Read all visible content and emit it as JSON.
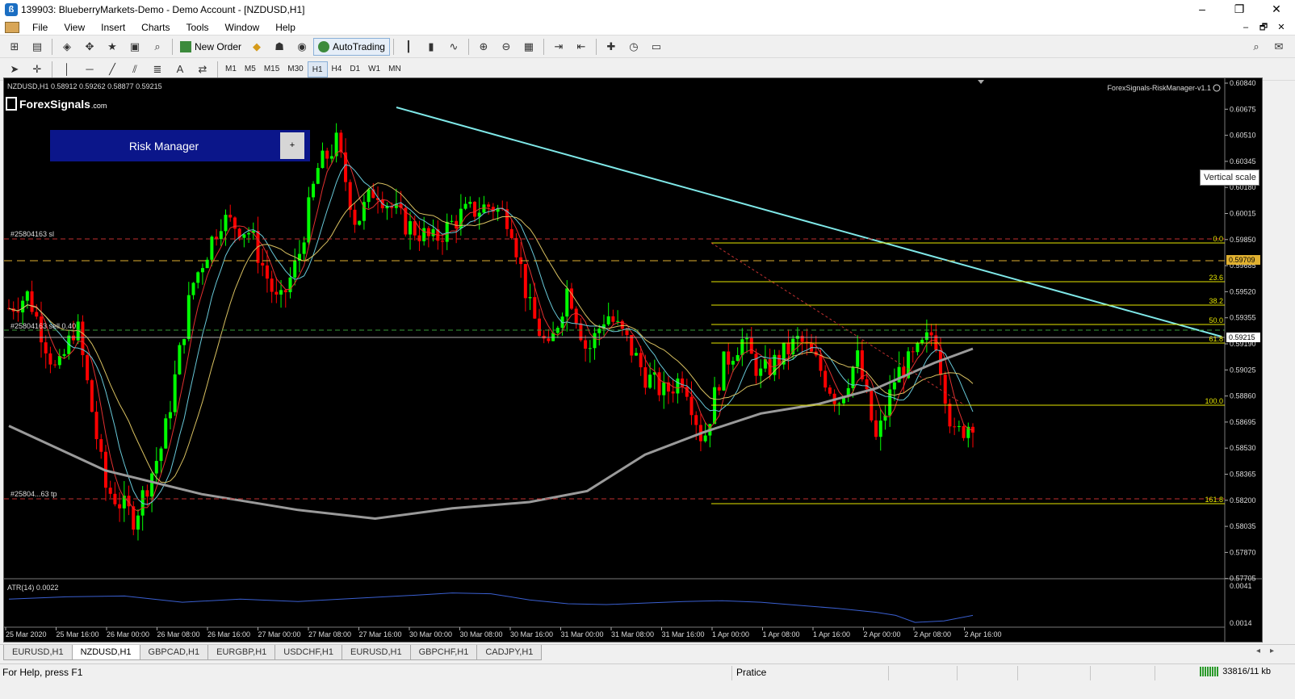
{
  "window": {
    "title": "139903: BlueberryMarkets-Demo - Demo Account - [NZDUSD,H1]",
    "controls": [
      "–",
      "❐",
      "✕"
    ]
  },
  "menu": {
    "items": [
      "File",
      "View",
      "Insert",
      "Charts",
      "Tools",
      "Window",
      "Help"
    ],
    "mdi_controls": [
      "–",
      "🗗",
      "✕"
    ]
  },
  "toolbar": {
    "new_order": "New Order",
    "autotrading": "AutoTrading",
    "timeframes": [
      "M1",
      "M5",
      "M15",
      "M30",
      "H1",
      "H4",
      "D1",
      "W1",
      "MN"
    ],
    "active_timeframe": "H1"
  },
  "chart": {
    "symbol_info": "NZDUSD,H1  0.58912 0.59262 0.58877 0.59215",
    "ea_label": "ForexSignals-RiskManager-v1.1",
    "logo_text": "ForexSignals",
    "logo_suffix": ".com",
    "risk_manager_label": "Risk Manager",
    "risk_manager_plus": "+",
    "vertical_scale_tooltip": "Vertical scale",
    "order_lines": {
      "sl": "#25804163 sl",
      "sell": "#25804163 sell 0.40",
      "tp": "#25804...63 tp"
    },
    "fib_levels": [
      "0.0",
      "23.6",
      "38.2",
      "50.0",
      "61.8",
      "100.0",
      "161.8"
    ],
    "price_labels": [
      "0.60840",
      "0.60675",
      "0.60510",
      "0.60345",
      "0.60180",
      "0.60015",
      "0.59850",
      "0.59685",
      "0.59520",
      "0.59355",
      "0.59190",
      "0.59025",
      "0.58860",
      "0.58695",
      "0.58530",
      "0.58365",
      "0.58200",
      "0.58035",
      "0.57870",
      "0.57705"
    ],
    "highlight_prices": {
      "sl_price": "0.59709",
      "current_price": "0.59215"
    },
    "time_labels": [
      "25 Mar 2020",
      "25 Mar 16:00",
      "26 Mar 00:00",
      "26 Mar 08:00",
      "26 Mar 16:00",
      "27 Mar 00:00",
      "27 Mar 08:00",
      "27 Mar 16:00",
      "30 Mar 00:00",
      "30 Mar 08:00",
      "30 Mar 16:00",
      "31 Mar 00:00",
      "31 Mar 08:00",
      "31 Mar 16:00",
      "1 Apr 00:00",
      "1 Apr 08:00",
      "1 Apr 16:00",
      "2 Apr 00:00",
      "2 Apr 08:00",
      "2 Apr 16:00"
    ],
    "atr": {
      "label": "ATR(14) 0.0022",
      "scale_top": "0.0041",
      "scale_bottom": "0.0014"
    },
    "colors": {
      "bull": "#00ff00",
      "bear": "#ff0000",
      "trendline": "#7fe8e8",
      "fib": "#e6e600",
      "ma_slow": "#9a9a9a",
      "atr": "#3a5fd0"
    }
  },
  "tabs": [
    "EURUSD,H1",
    "NZDUSD,H1",
    "GBPCAD,H1",
    "EURGBP,H1",
    "USDCHF,H1",
    "EURUSD,H1",
    "GBPCHF,H1",
    "CADJPY,H1"
  ],
  "active_tab": "NZDUSD,H1",
  "status": {
    "help": "For Help, press F1",
    "profile": "Pratice",
    "traffic": "33816/11 kb"
  }
}
